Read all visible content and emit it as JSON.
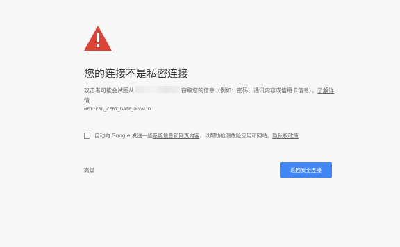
{
  "colors": {
    "background": "#f7f7f7",
    "warning_red": "#db4437",
    "primary_button": "#4285f4"
  },
  "warning_icon": "warning-triangle-icon",
  "heading": "您的连接不是私密连接",
  "description": {
    "prefix": "攻击者可能会试图从",
    "suffix": "窃取您的信息（例如：密码、通讯内容或信用卡信息）。",
    "learn_more": "了解详情"
  },
  "error_code": "NET::ERR_CERT_DATE_INVALID",
  "optin": {
    "checked": false,
    "text_before": "自动向 Google 发送一些",
    "link_system_info": "系统信息和网页内容",
    "text_after": "，以帮助检测危险应用和网站。",
    "link_privacy": "隐私权政策"
  },
  "buttons": {
    "advanced": "高级",
    "back_to_safety": "返回安全连接"
  }
}
